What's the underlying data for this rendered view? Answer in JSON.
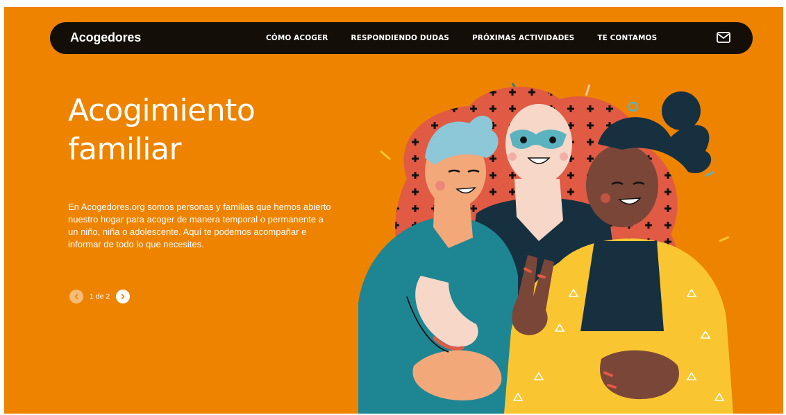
{
  "header": {
    "brand": "Acogedores",
    "nav": [
      {
        "label": "CÓMO ACOGER"
      },
      {
        "label": "RESPONDIENDO DUDAS"
      },
      {
        "label": "PRÓXIMAS ACTIVIDADES"
      },
      {
        "label": "TE CONTAMOS"
      }
    ],
    "mail_icon": "envelope-icon"
  },
  "hero": {
    "title_line1": "Acogimiento",
    "title_line2": "familiar",
    "text": "En Acogedores.org somos personas y familias que hemos abierto nuestro hogar para acoger de manera temporal o permanente a un niño, niña o adolescente. Aquí te podemos acompañar e informar de todo lo que necesites.",
    "pager": {
      "label": "1 de 2",
      "prev_icon": "chevron-left-icon",
      "next_icon": "chevron-right-icon"
    }
  },
  "colors": {
    "background": "#ee8300",
    "navbar": "#140e08",
    "text": "#ffffff",
    "illustration_bg": "#e05a44",
    "teal_shirt": "#1e8593",
    "yellow_shirt": "#f9c632",
    "dark_navy": "#163040"
  }
}
